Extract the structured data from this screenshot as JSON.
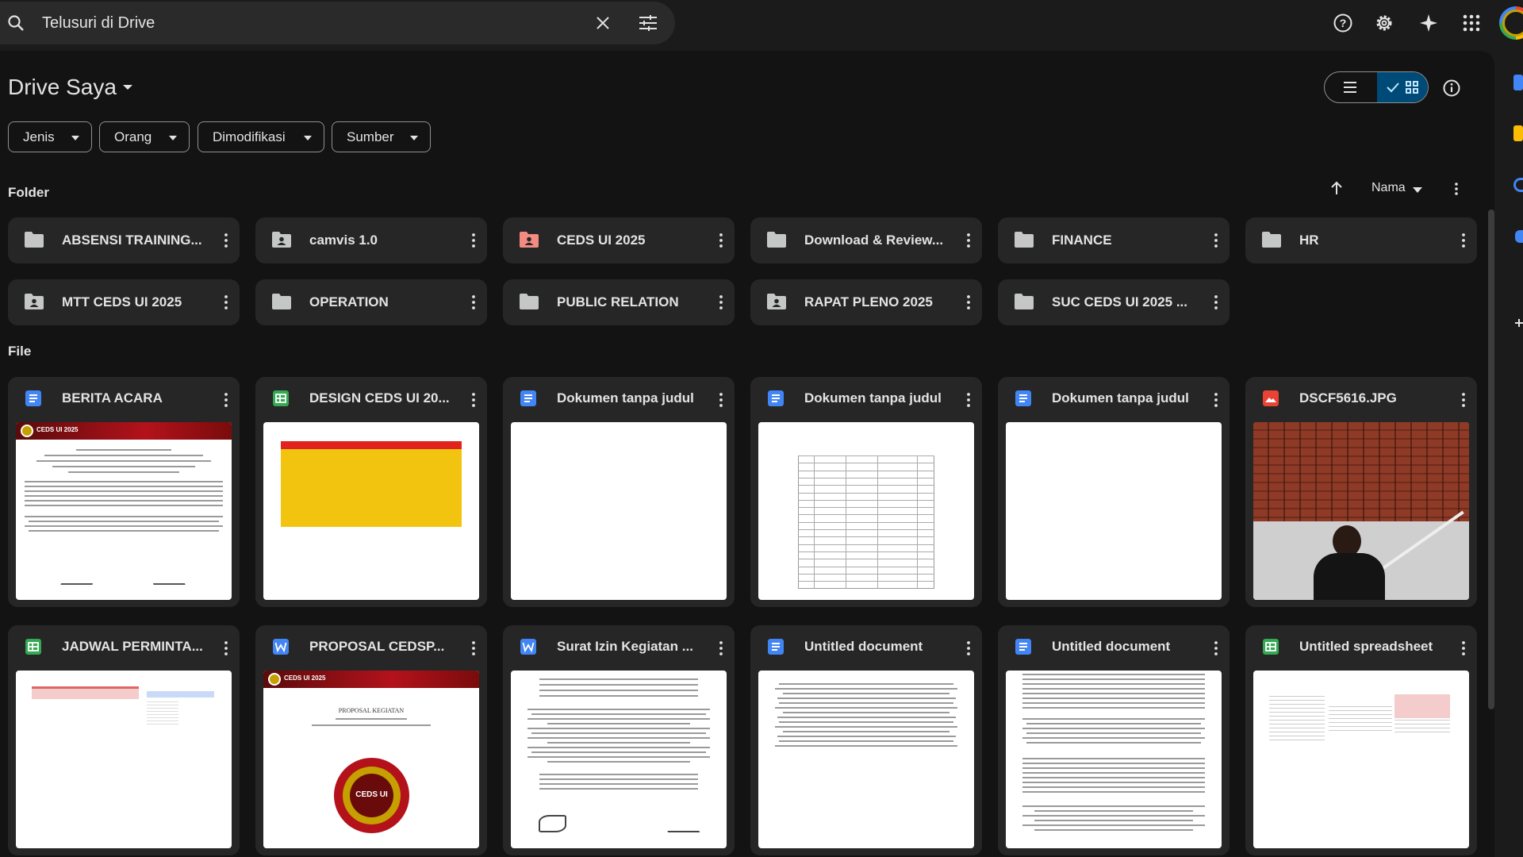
{
  "search": {
    "placeholder": "Telusuri di Drive"
  },
  "page": {
    "title": "Drive Saya"
  },
  "filters": [
    "Jenis",
    "Orang",
    "Dimodifikasi",
    "Sumber"
  ],
  "sections": {
    "folders": "Folder",
    "files": "File"
  },
  "sort": {
    "label": "Nama"
  },
  "folders": [
    {
      "name": "ABSENSI TRAINING...",
      "icon": "folder-icon"
    },
    {
      "name": "camvis 1.0",
      "icon": "shared-folder-icon"
    },
    {
      "name": "CEDS UI 2025",
      "icon": "shared-folder-icon",
      "color": "#f28b82"
    },
    {
      "name": "Download & Review...",
      "icon": "folder-icon"
    },
    {
      "name": "FINANCE",
      "icon": "folder-icon"
    },
    {
      "name": "HR",
      "icon": "folder-icon"
    },
    {
      "name": "MTT CEDS UI 2025",
      "icon": "shared-folder-icon"
    },
    {
      "name": "OPERATION",
      "icon": "folder-icon"
    },
    {
      "name": "PUBLIC RELATION",
      "icon": "folder-icon"
    },
    {
      "name": "RAPAT PLENO 2025",
      "icon": "shared-folder-icon"
    },
    {
      "name": "SUC CEDS UI 2025 ...",
      "icon": "folder-icon"
    }
  ],
  "files": [
    {
      "name": "BERITA ACARA",
      "type": "docs",
      "color": "#4285f4"
    },
    {
      "name": "DESIGN CEDS UI 20...",
      "type": "sheets",
      "color": "#34a853"
    },
    {
      "name": "Dokumen tanpa judul",
      "type": "docs",
      "color": "#4285f4"
    },
    {
      "name": "Dokumen tanpa judul",
      "type": "docs",
      "color": "#4285f4"
    },
    {
      "name": "Dokumen tanpa judul",
      "type": "docs",
      "color": "#4285f4"
    },
    {
      "name": "DSCF5616.JPG",
      "type": "image",
      "color": "#ea4335"
    },
    {
      "name": "JADWAL PERMINTA...",
      "type": "sheets",
      "color": "#34a853"
    },
    {
      "name": "PROPOSAL CEDSP...",
      "type": "word",
      "color": "#4285f4"
    },
    {
      "name": "Surat Izin Kegiatan ...",
      "type": "word",
      "color": "#4285f4"
    },
    {
      "name": "Untitled document",
      "type": "docs",
      "color": "#4285f4"
    },
    {
      "name": "Untitled document",
      "type": "docs",
      "color": "#4285f4"
    },
    {
      "name": "Untitled spreadsheet",
      "type": "sheets",
      "color": "#34a853"
    }
  ],
  "thumbs": {
    "ceds_badge": "CEDS UI 2025",
    "ceds_logo": "CEDS UI",
    "proposal": "PROPOSAL KEGIATAN"
  },
  "colors": {
    "accent": "#004a77",
    "background": "#131313",
    "card": "#262626"
  }
}
